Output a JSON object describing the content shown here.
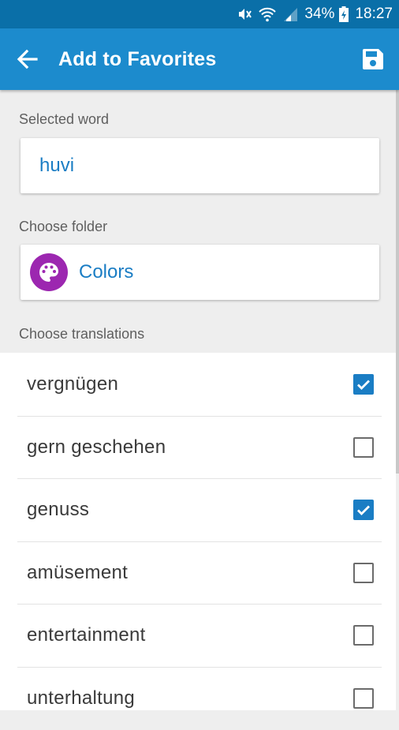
{
  "status_bar": {
    "battery": "34%",
    "time": "18:27",
    "icons": [
      "mute-icon",
      "wifi-icon",
      "signal-icon",
      "battery-charging-icon"
    ]
  },
  "app_bar": {
    "back_icon": "arrow-left-icon",
    "title": "Add to Favorites",
    "save_icon": "floppy-disk-icon",
    "color": "#1c8bcd"
  },
  "selected_word": {
    "label": "Selected word",
    "value": "huvi"
  },
  "folder": {
    "label": "Choose folder",
    "name": "Colors",
    "icon": "palette-icon",
    "icon_color": "#9c27b0"
  },
  "translations": {
    "label": "Choose translations",
    "items": [
      {
        "text": "vergnügen",
        "checked": true
      },
      {
        "text": "gern geschehen",
        "checked": false
      },
      {
        "text": "genuss",
        "checked": true
      },
      {
        "text": "amüsement",
        "checked": false
      },
      {
        "text": "entertainment",
        "checked": false
      },
      {
        "text": "unterhaltung",
        "checked": false
      }
    ]
  },
  "colors": {
    "accent": "#1a7dc4",
    "status_bar": "#0a6fa8"
  }
}
